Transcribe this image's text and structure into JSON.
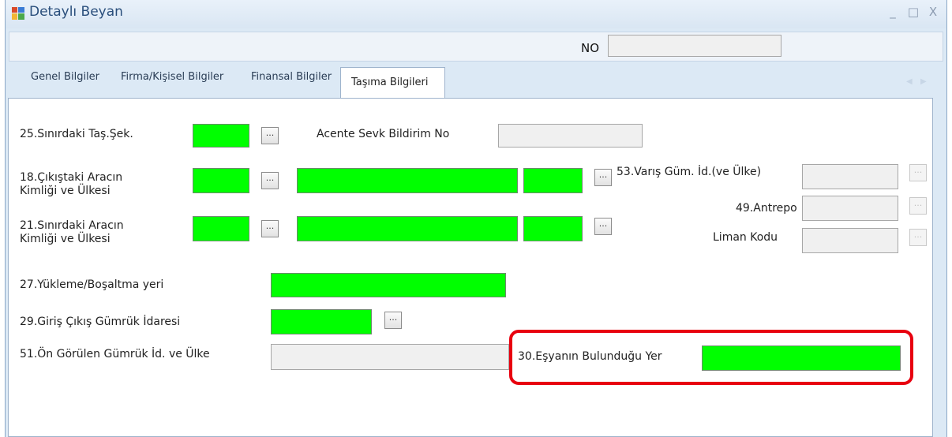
{
  "window": {
    "title": "Detaylı Beyan",
    "controls": {
      "minimize": "_",
      "maximize": "□",
      "close": "X"
    }
  },
  "header": {
    "no_label": "NO",
    "no_value": ""
  },
  "tabs": [
    {
      "label": "Genel Bilgiler"
    },
    {
      "label": "Firma/Kişisel Bilgiler"
    },
    {
      "label": "Finansal Bilgiler"
    },
    {
      "label": "Taşıma Bilgileri"
    }
  ],
  "tab_scroll": {
    "left": "◀",
    "right": "▶"
  },
  "form": {
    "f25_label": "25.Sınırdaki Taş.Şek.",
    "acente_label": "Acente Sevk Bildirim No",
    "f18_label_line1": "18.Çıkıştaki Aracın",
    "f18_label_line2": "Kimliği ve Ülkesi",
    "f53_label": "53.Varış Güm. İd.(ve Ülke)",
    "f49_label": "49.Antrepo",
    "f21_label_line1": "21.Sınırdaki Aracın",
    "f21_label_line2": "Kimliği ve Ülkesi",
    "liman_label": "Liman Kodu",
    "f27_label": "27.Yükleme/Boşaltma yeri",
    "f29_label": "29.Giriş Çıkış Gümrük İdaresi",
    "f51_label": "51.Ön Görülen Gümrük İd. ve Ülke",
    "f30_label": "30.Eşyanın Bulunduğu Yer",
    "lookup_glyph": "..."
  },
  "colors": {
    "required_field": "#00ff00",
    "highlight": "#e8000f",
    "title_text": "#2a4f7c"
  },
  "icons": {
    "app": "app-window-icon"
  }
}
